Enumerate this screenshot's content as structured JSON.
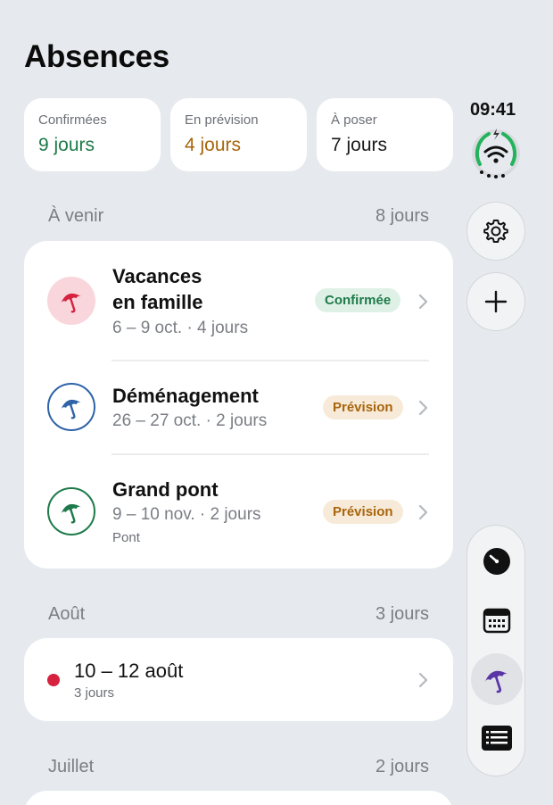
{
  "page": {
    "title": "Absences"
  },
  "summary": [
    {
      "label": "Confirmées",
      "value": "9 jours",
      "color": "#1e7a4a"
    },
    {
      "label": "En prévision",
      "value": "4 jours",
      "color": "#a8650c"
    },
    {
      "label": "À poser",
      "value": "7 jours",
      "color": "#1a1a1a"
    }
  ],
  "status": {
    "time": "09:41"
  },
  "sections": {
    "upcoming": {
      "label": "À venir",
      "total": "8 jours",
      "items": [
        {
          "title_line1": "Vacances",
          "title_line2": "en famille",
          "dates": "6 – 9 oct. · 4 jours",
          "badge": "Confirmée",
          "icon": "umbrella-icon",
          "color": "#d6213f"
        },
        {
          "title_line1": "Déménagement",
          "dates": "26 – 27 oct. · 2 jours",
          "badge": "Prévision",
          "icon": "umbrella-icon",
          "color": "#2e63a8"
        },
        {
          "title_line1": "Grand pont",
          "dates": "9 – 10 nov. · 2 jours",
          "note": "Pont",
          "badge": "Prévision",
          "icon": "umbrella-icon",
          "color": "#1e7a4a"
        }
      ]
    },
    "august": {
      "label": "Août",
      "total": "3 jours",
      "items": [
        {
          "title": "10 – 12 août",
          "sub": "3 jours",
          "dot_color": "#d6213f"
        }
      ]
    },
    "july": {
      "label": "Juillet",
      "total": "2 jours"
    }
  },
  "nav": [
    "dashboard-icon",
    "calendar-icon",
    "umbrella-icon",
    "list-icon"
  ]
}
